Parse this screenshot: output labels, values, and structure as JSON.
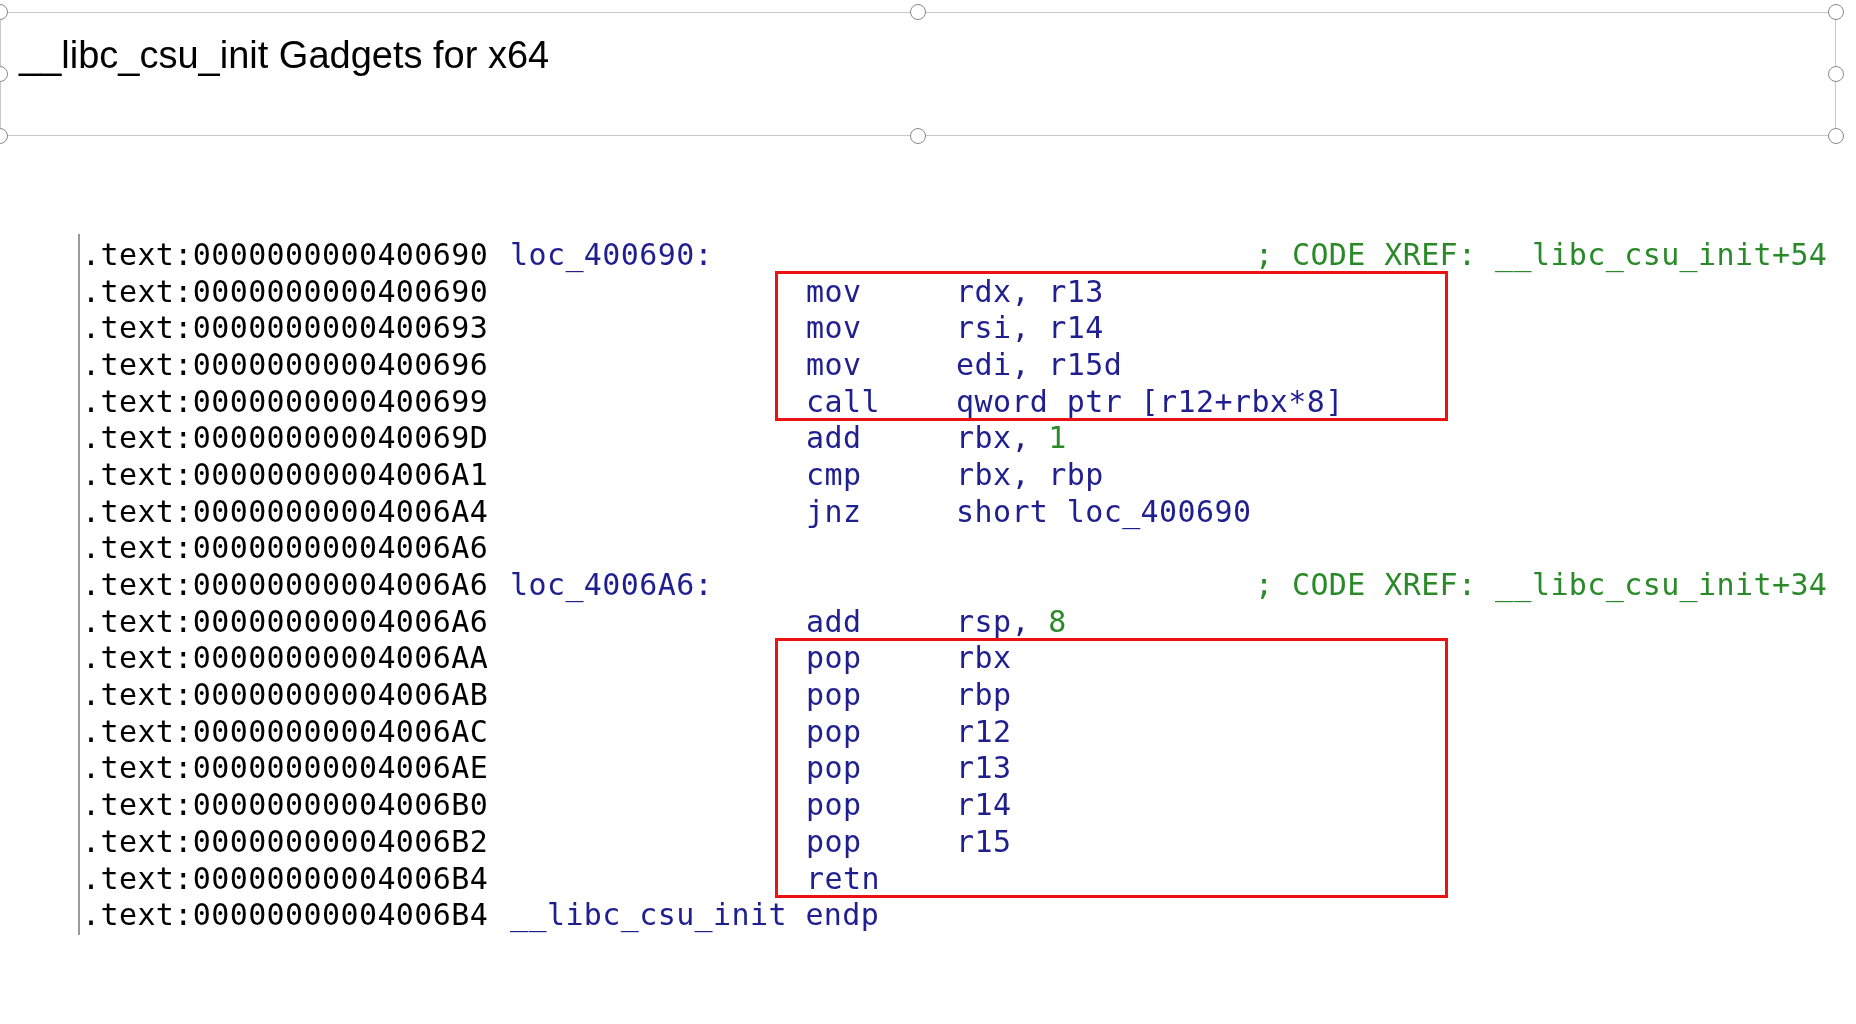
{
  "slide_title": "__libc_csu_init Gadgets for x64",
  "blocks": [
    {
      "highlighted": false,
      "rows": [
        {
          "address": ".text:0000000000400690",
          "label": "loc_400690:",
          "comment": "; CODE XREF: __libc_csu_init+54"
        }
      ]
    },
    {
      "highlighted": true,
      "rows": [
        {
          "address": ".text:0000000000400690",
          "mnemonic": "mov",
          "operands": [
            {
              "text": "rdx, r13",
              "kind": "plain"
            }
          ]
        },
        {
          "address": ".text:0000000000400693",
          "mnemonic": "mov",
          "operands": [
            {
              "text": "rsi, r14",
              "kind": "plain"
            }
          ]
        },
        {
          "address": ".text:0000000000400696",
          "mnemonic": "mov",
          "operands": [
            {
              "text": "edi, r15d",
              "kind": "plain"
            }
          ]
        },
        {
          "address": ".text:0000000000400699",
          "mnemonic": "call",
          "operands": [
            {
              "text": "qword ptr [r12+rbx*8]",
              "kind": "plain"
            }
          ]
        }
      ]
    },
    {
      "highlighted": false,
      "rows": [
        {
          "address": ".text:000000000040069D",
          "mnemonic": "add",
          "operands": [
            {
              "text": "rbx, ",
              "kind": "plain"
            },
            {
              "text": "1",
              "kind": "number"
            }
          ]
        },
        {
          "address": ".text:00000000004006A1",
          "mnemonic": "cmp",
          "operands": [
            {
              "text": "rbx, rbp",
              "kind": "plain"
            }
          ]
        },
        {
          "address": ".text:00000000004006A4",
          "mnemonic": "jnz",
          "operands": [
            {
              "text": "short loc_400690",
              "kind": "plain"
            }
          ]
        },
        {
          "address": ".text:00000000004006A6"
        },
        {
          "address": ".text:00000000004006A6",
          "label": "loc_4006A6:",
          "comment": "; CODE XREF: __libc_csu_init+34"
        },
        {
          "address": ".text:00000000004006A6",
          "mnemonic": "add",
          "operands": [
            {
              "text": "rsp, ",
              "kind": "plain"
            },
            {
              "text": "8",
              "kind": "number"
            }
          ]
        }
      ]
    },
    {
      "highlighted": true,
      "rows": [
        {
          "address": ".text:00000000004006AA",
          "mnemonic": "pop",
          "operands": [
            {
              "text": "rbx",
              "kind": "plain"
            }
          ]
        },
        {
          "address": ".text:00000000004006AB",
          "mnemonic": "pop",
          "operands": [
            {
              "text": "rbp",
              "kind": "plain"
            }
          ]
        },
        {
          "address": ".text:00000000004006AC",
          "mnemonic": "pop",
          "operands": [
            {
              "text": "r12",
              "kind": "plain"
            }
          ]
        },
        {
          "address": ".text:00000000004006AE",
          "mnemonic": "pop",
          "operands": [
            {
              "text": "r13",
              "kind": "plain"
            }
          ]
        },
        {
          "address": ".text:00000000004006B0",
          "mnemonic": "pop",
          "operands": [
            {
              "text": "r14",
              "kind": "plain"
            }
          ]
        },
        {
          "address": ".text:00000000004006B2",
          "mnemonic": "pop",
          "operands": [
            {
              "text": "r15",
              "kind": "plain"
            }
          ]
        },
        {
          "address": ".text:00000000004006B4",
          "mnemonic": "retn"
        }
      ]
    },
    {
      "highlighted": false,
      "rows": [
        {
          "address": ".text:00000000004006B4",
          "label": "__libc_csu_init endp"
        }
      ]
    }
  ]
}
